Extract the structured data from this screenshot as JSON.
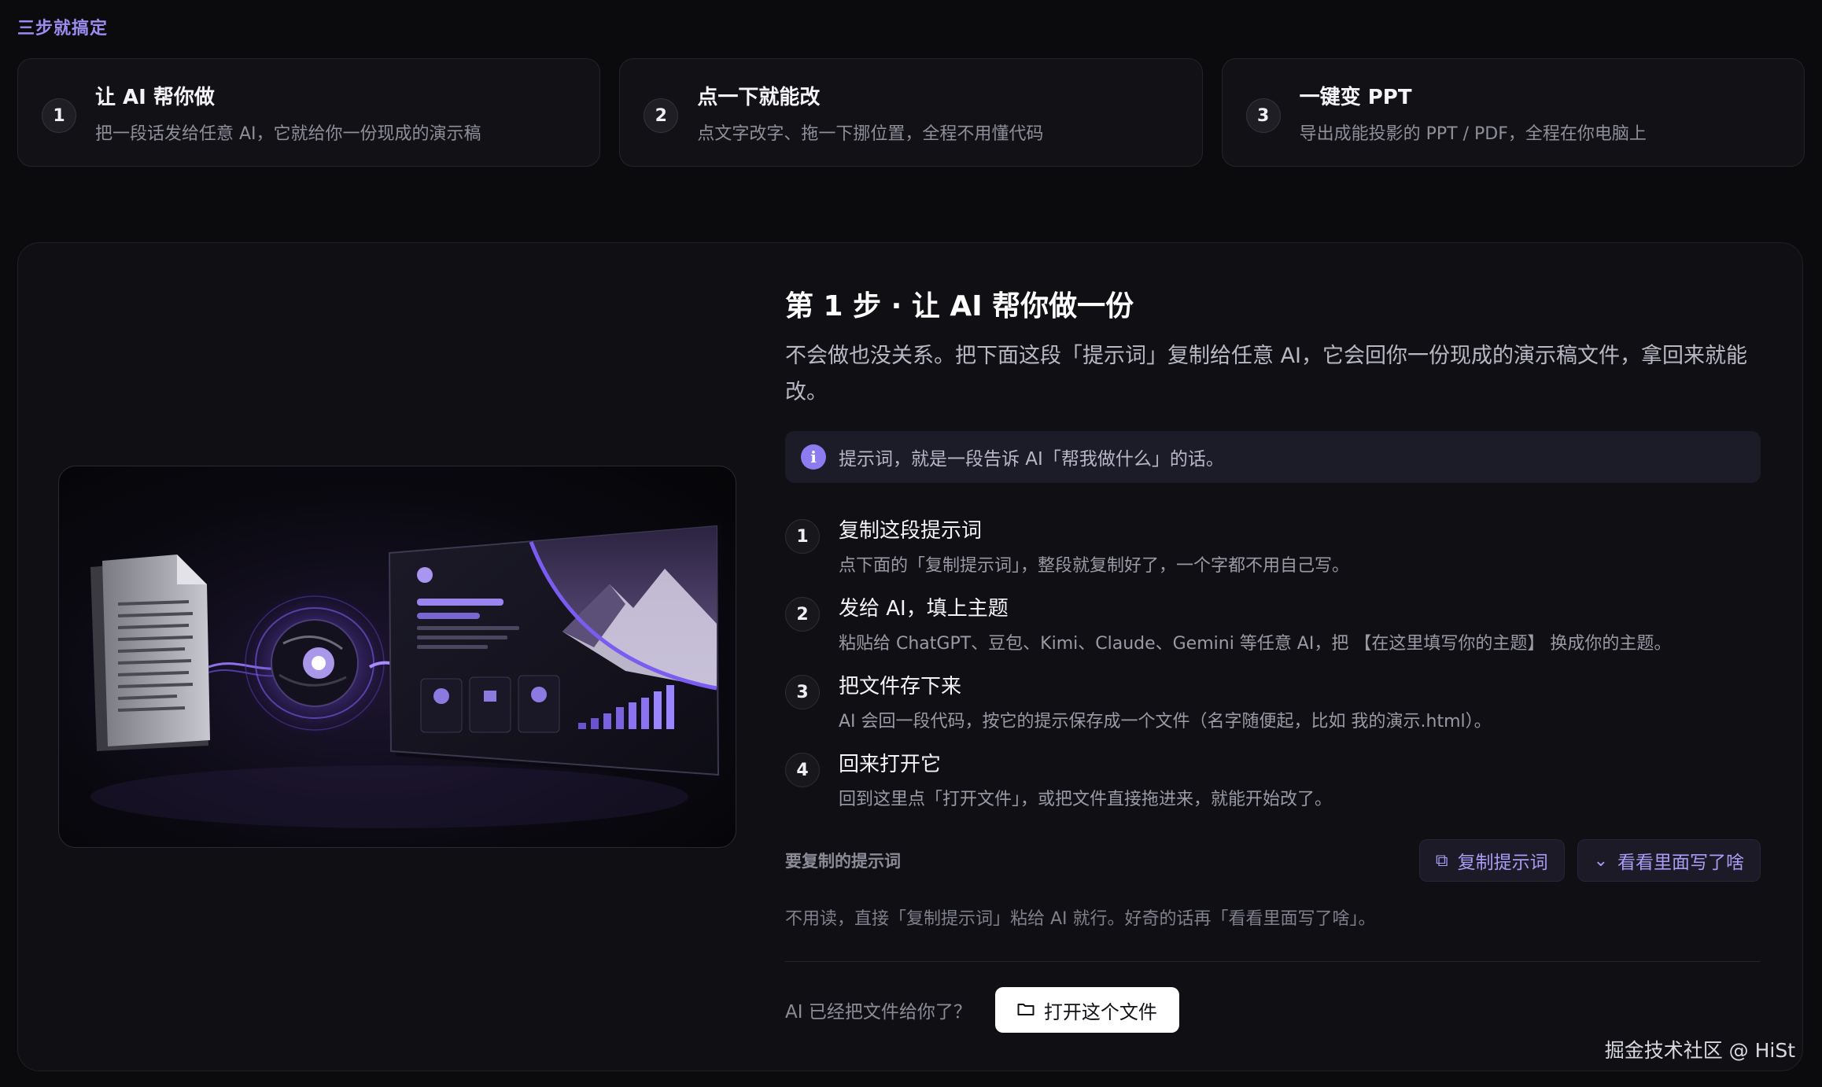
{
  "section_label": "三步就搞定",
  "steps": [
    {
      "num": "1",
      "title": "让 AI 帮你做",
      "desc": "把一段话发给任意 AI，它就给你一份现成的演示稿"
    },
    {
      "num": "2",
      "title": "点一下就能改",
      "desc": "点文字改字、拖一下挪位置，全程不用懂代码"
    },
    {
      "num": "3",
      "title": "一键变 PPT",
      "desc": "导出成能投影的 PPT / PDF，全程在你电脑上"
    }
  ],
  "main": {
    "heading": "第 1 步 · 让 AI 帮你做一份",
    "lead": "不会做也没关系。把下面这段「提示词」复制给任意 AI，它会回你一份现成的演示稿文件，拿回来就能改。",
    "info": "提示词，就是一段告诉 AI「帮我做什么」的话。",
    "substeps": [
      {
        "num": "1",
        "title": "复制这段提示词",
        "desc": "点下面的「复制提示词」，整段就复制好了，一个字都不用自己写。"
      },
      {
        "num": "2",
        "title": "发给 AI，填上主题",
        "desc": "粘贴给 ChatGPT、豆包、Kimi、Claude、Gemini 等任意 AI，把 【在这里填写你的主题】 换成你的主题。"
      },
      {
        "num": "3",
        "title": "把文件存下来",
        "desc": "AI 会回一段代码，按它的提示保存成一个文件（名字随便起，比如 我的演示.html）。"
      },
      {
        "num": "4",
        "title": "回来打开它",
        "desc": "回到这里点「打开文件」，或把文件直接拖进来，就能开始改了。"
      }
    ],
    "prompt_label": "要复制的提示词",
    "copy_button": "复制提示词",
    "view_button": "看看里面写了啥",
    "hint": "不用读，直接「复制提示词」粘给 AI 就行。好奇的话再「看看里面写了啥」。",
    "open_label": "AI 已经把文件给你了？",
    "open_button": "打开这个文件"
  },
  "hero_icons": [
    "document-icon",
    "ai-orb-icon",
    "slide-mockup-icon"
  ],
  "watermark": "掘金技术社区 @ HiSt",
  "colors": {
    "accent": "#8c7cf0",
    "background": "#0b0b0e",
    "panel": "#101014"
  }
}
